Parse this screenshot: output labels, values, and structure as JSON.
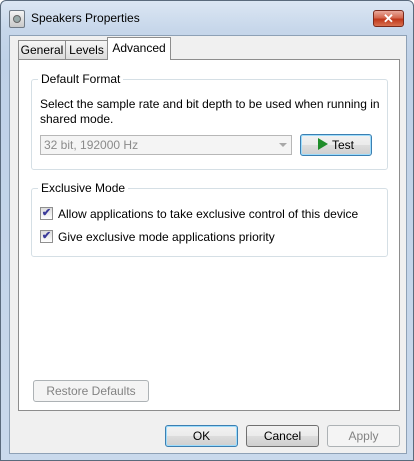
{
  "window": {
    "title": "Speakers Properties",
    "close_label": "✕"
  },
  "tabs": [
    {
      "label": "General"
    },
    {
      "label": "Levels"
    },
    {
      "label": "Advanced"
    }
  ],
  "default_format": {
    "heading": "Default Format",
    "description": "Select the sample rate and bit depth to be used when running in shared mode.",
    "selected_format": "32 bit, 192000 Hz",
    "test_label": "Test"
  },
  "exclusive_mode": {
    "heading": "Exclusive Mode",
    "options": [
      {
        "label": "Allow applications to take exclusive control of this device",
        "checked": true,
        "mark": "✔"
      },
      {
        "label": "Give exclusive mode applications priority",
        "checked": true,
        "mark": "✔"
      }
    ]
  },
  "restore_defaults_label": "Restore Defaults",
  "footer": {
    "ok": "OK",
    "cancel": "Cancel",
    "apply": "Apply"
  },
  "colors": {
    "play_icon": "#1f8c2a",
    "close_button": "#c0381b"
  }
}
